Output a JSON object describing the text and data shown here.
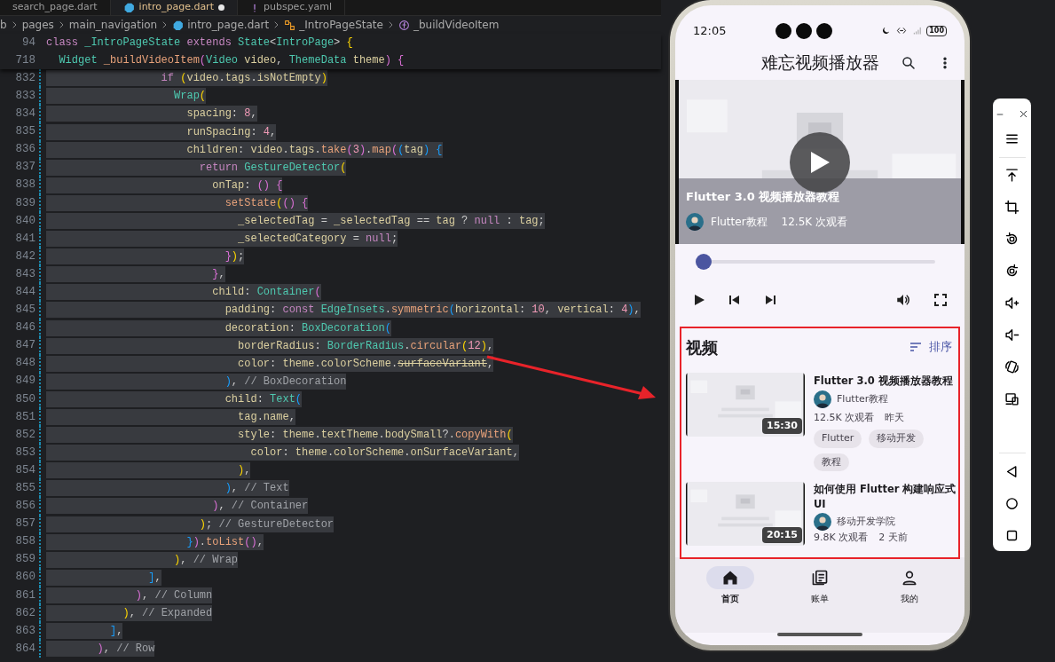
{
  "editor": {
    "tabs": [
      {
        "label": "search_page.dart",
        "kind": "plain",
        "selected": false,
        "modified": false
      },
      {
        "label": "intro_page.dart",
        "kind": "dart",
        "selected": true,
        "modified": true
      },
      {
        "label": "pubspec.yaml",
        "kind": "yaml",
        "selected": false,
        "modified": false
      }
    ],
    "breadcrumb": [
      {
        "label": "b",
        "kind": "folder"
      },
      {
        "label": "pages",
        "kind": "folder"
      },
      {
        "label": "main_navigation",
        "kind": "folder"
      },
      {
        "label": "intro_page.dart",
        "kind": "file"
      },
      {
        "label": "_IntroPageState",
        "kind": "class"
      },
      {
        "label": "_buildVideoItem",
        "kind": "method"
      }
    ],
    "sticky_lines": [
      {
        "number": "94",
        "tokens": [
          {
            "text": "class",
            "kind": "kw"
          },
          {
            "text": " _IntroPageState",
            "kind": "cls"
          },
          {
            "text": " extends",
            "kind": "kw"
          },
          {
            "text": " State",
            "kind": "cls"
          },
          {
            "text": "<",
            "kind": "p"
          },
          {
            "text": "IntroPage",
            "kind": "cls"
          },
          {
            "text": "> ",
            "kind": "p"
          },
          {
            "text": "{",
            "kind": "br1"
          }
        ]
      },
      {
        "number": "718",
        "tokens": [
          {
            "text": "  Widget",
            "kind": "cls"
          },
          {
            "text": " _buildVideoItem",
            "kind": "fn"
          },
          {
            "text": "(",
            "kind": "br2"
          },
          {
            "text": "Video",
            "kind": "cls"
          },
          {
            "text": " video",
            "kind": "id"
          },
          {
            "text": ", ",
            "kind": "p"
          },
          {
            "text": "ThemeData",
            "kind": "cls"
          },
          {
            "text": " theme",
            "kind": "id"
          },
          {
            "text": ")",
            "kind": "br2"
          },
          {
            "text": " {",
            "kind": "br2"
          }
        ]
      }
    ],
    "lines": [
      {
        "number": "832",
        "tokens": [
          {
            "text": "                  if",
            "kind": "kw"
          },
          {
            "text": " (",
            "kind": "br1"
          },
          {
            "text": "video",
            "kind": "id"
          },
          {
            "text": ".",
            "kind": "p"
          },
          {
            "text": "tags",
            "kind": "id"
          },
          {
            "text": ".",
            "kind": "p"
          },
          {
            "text": "isNotEmpty",
            "kind": "id"
          },
          {
            "text": ")",
            "kind": "br1"
          }
        ]
      },
      {
        "number": "833",
        "tokens": [
          {
            "text": "                    Wrap",
            "kind": "cls"
          },
          {
            "text": "(",
            "kind": "br1"
          }
        ]
      },
      {
        "number": "834",
        "tokens": [
          {
            "text": "                      spacing",
            "kind": "id"
          },
          {
            "text": ": ",
            "kind": "p"
          },
          {
            "text": "8",
            "kind": "num"
          },
          {
            "text": ",",
            "kind": "p"
          }
        ]
      },
      {
        "number": "835",
        "tokens": [
          {
            "text": "                      runSpacing",
            "kind": "id"
          },
          {
            "text": ": ",
            "kind": "p"
          },
          {
            "text": "4",
            "kind": "num"
          },
          {
            "text": ",",
            "kind": "p"
          }
        ]
      },
      {
        "number": "836",
        "tokens": [
          {
            "text": "                      children",
            "kind": "id"
          },
          {
            "text": ": ",
            "kind": "p"
          },
          {
            "text": "video",
            "kind": "id"
          },
          {
            "text": ".",
            "kind": "p"
          },
          {
            "text": "tags",
            "kind": "id"
          },
          {
            "text": ".",
            "kind": "p"
          },
          {
            "text": "take",
            "kind": "fn"
          },
          {
            "text": "(",
            "kind": "br2"
          },
          {
            "text": "3",
            "kind": "num"
          },
          {
            "text": ")",
            "kind": "br2"
          },
          {
            "text": ".",
            "kind": "p"
          },
          {
            "text": "map",
            "kind": "fn"
          },
          {
            "text": "(",
            "kind": "br2"
          },
          {
            "text": "(",
            "kind": "br3"
          },
          {
            "text": "tag",
            "kind": "id"
          },
          {
            "text": ")",
            "kind": "br3"
          },
          {
            "text": " {",
            "kind": "br3"
          }
        ]
      },
      {
        "number": "837",
        "tokens": [
          {
            "text": "                        return",
            "kind": "kw"
          },
          {
            "text": " GestureDetector",
            "kind": "cls"
          },
          {
            "text": "(",
            "kind": "br1"
          }
        ]
      },
      {
        "number": "838",
        "tokens": [
          {
            "text": "                          onTap",
            "kind": "id"
          },
          {
            "text": ": ",
            "kind": "p"
          },
          {
            "text": "()",
            "kind": "br2"
          },
          {
            "text": " {",
            "kind": "br2"
          }
        ]
      },
      {
        "number": "839",
        "tokens": [
          {
            "text": "                            setState",
            "kind": "fn"
          },
          {
            "text": "(",
            "kind": "br1"
          },
          {
            "text": "()",
            "kind": "br2"
          },
          {
            "text": " {",
            "kind": "br2"
          }
        ]
      },
      {
        "number": "840",
        "tokens": [
          {
            "text": "                              _selectedTag",
            "kind": "id"
          },
          {
            "text": " = ",
            "kind": "p"
          },
          {
            "text": "_selectedTag",
            "kind": "id"
          },
          {
            "text": " == ",
            "kind": "p"
          },
          {
            "text": "tag",
            "kind": "id"
          },
          {
            "text": " ? ",
            "kind": "p"
          },
          {
            "text": "null",
            "kind": "kw"
          },
          {
            "text": " : ",
            "kind": "p"
          },
          {
            "text": "tag",
            "kind": "id"
          },
          {
            "text": ";",
            "kind": "p"
          }
        ]
      },
      {
        "number": "841",
        "tokens": [
          {
            "text": "                              _selectedCategory",
            "kind": "id"
          },
          {
            "text": " = ",
            "kind": "p"
          },
          {
            "text": "null",
            "kind": "kw"
          },
          {
            "text": ";",
            "kind": "p"
          }
        ]
      },
      {
        "number": "842",
        "tokens": [
          {
            "text": "                            }",
            "kind": "br2"
          },
          {
            "text": ")",
            "kind": "br1"
          },
          {
            "text": ";",
            "kind": "p"
          }
        ]
      },
      {
        "number": "843",
        "tokens": [
          {
            "text": "                          }",
            "kind": "br2"
          },
          {
            "text": ",",
            "kind": "p"
          }
        ]
      },
      {
        "number": "844",
        "tokens": [
          {
            "text": "                          child",
            "kind": "id"
          },
          {
            "text": ": ",
            "kind": "p"
          },
          {
            "text": "Container",
            "kind": "cls"
          },
          {
            "text": "(",
            "kind": "br2"
          }
        ]
      },
      {
        "number": "845",
        "tokens": [
          {
            "text": "                            padding",
            "kind": "id"
          },
          {
            "text": ": ",
            "kind": "p"
          },
          {
            "text": "const",
            "kind": "kw"
          },
          {
            "text": " EdgeInsets",
            "kind": "cls"
          },
          {
            "text": ".",
            "kind": "p"
          },
          {
            "text": "symmetric",
            "kind": "fn"
          },
          {
            "text": "(",
            "kind": "br3"
          },
          {
            "text": "horizontal",
            "kind": "id"
          },
          {
            "text": ": ",
            "kind": "p"
          },
          {
            "text": "10",
            "kind": "num"
          },
          {
            "text": ", ",
            "kind": "p"
          },
          {
            "text": "vertical",
            "kind": "id"
          },
          {
            "text": ": ",
            "kind": "p"
          },
          {
            "text": "4",
            "kind": "num"
          },
          {
            "text": ")",
            "kind": "br3"
          },
          {
            "text": ",",
            "kind": "p"
          }
        ]
      },
      {
        "number": "846",
        "tokens": [
          {
            "text": "                            decoration",
            "kind": "id"
          },
          {
            "text": ": ",
            "kind": "p"
          },
          {
            "text": "BoxDecoration",
            "kind": "cls"
          },
          {
            "text": "(",
            "kind": "br3"
          }
        ]
      },
      {
        "number": "847",
        "tokens": [
          {
            "text": "                              borderRadius",
            "kind": "id"
          },
          {
            "text": ": ",
            "kind": "p"
          },
          {
            "text": "BorderRadius",
            "kind": "cls"
          },
          {
            "text": ".",
            "kind": "p"
          },
          {
            "text": "circular",
            "kind": "fn"
          },
          {
            "text": "(",
            "kind": "br1"
          },
          {
            "text": "12",
            "kind": "num"
          },
          {
            "text": ")",
            "kind": "br1"
          },
          {
            "text": ",",
            "kind": "p"
          }
        ]
      },
      {
        "number": "848",
        "tokens": [
          {
            "text": "                              color",
            "kind": "id"
          },
          {
            "text": ": ",
            "kind": "p"
          },
          {
            "text": "theme",
            "kind": "id"
          },
          {
            "text": ".",
            "kind": "p"
          },
          {
            "text": "colorScheme",
            "kind": "id"
          },
          {
            "text": ".",
            "kind": "p"
          },
          {
            "text": "surfaceVariant",
            "kind": "dep"
          },
          {
            "text": ",",
            "kind": "p"
          }
        ]
      },
      {
        "number": "849",
        "tokens": [
          {
            "text": "                            )",
            "kind": "br3"
          },
          {
            "text": ", ",
            "kind": "p"
          },
          {
            "text": "// BoxDecoration",
            "kind": "cm"
          }
        ]
      },
      {
        "number": "850",
        "tokens": [
          {
            "text": "                            child",
            "kind": "id"
          },
          {
            "text": ": ",
            "kind": "p"
          },
          {
            "text": "Text",
            "kind": "cls"
          },
          {
            "text": "(",
            "kind": "br3"
          }
        ]
      },
      {
        "number": "851",
        "tokens": [
          {
            "text": "                              tag",
            "kind": "id"
          },
          {
            "text": ".",
            "kind": "p"
          },
          {
            "text": "name",
            "kind": "id"
          },
          {
            "text": ",",
            "kind": "p"
          }
        ]
      },
      {
        "number": "852",
        "tokens": [
          {
            "text": "                              style",
            "kind": "id"
          },
          {
            "text": ": ",
            "kind": "p"
          },
          {
            "text": "theme",
            "kind": "id"
          },
          {
            "text": ".",
            "kind": "p"
          },
          {
            "text": "textTheme",
            "kind": "id"
          },
          {
            "text": ".",
            "kind": "p"
          },
          {
            "text": "bodySmall",
            "kind": "id"
          },
          {
            "text": "?.",
            "kind": "p"
          },
          {
            "text": "copyWith",
            "kind": "fn"
          },
          {
            "text": "(",
            "kind": "br1"
          }
        ]
      },
      {
        "number": "853",
        "tokens": [
          {
            "text": "                                color",
            "kind": "id"
          },
          {
            "text": ": ",
            "kind": "p"
          },
          {
            "text": "theme",
            "kind": "id"
          },
          {
            "text": ".",
            "kind": "p"
          },
          {
            "text": "colorScheme",
            "kind": "id"
          },
          {
            "text": ".",
            "kind": "p"
          },
          {
            "text": "onSurfaceVariant",
            "kind": "id"
          },
          {
            "text": ",",
            "kind": "p"
          }
        ]
      },
      {
        "number": "854",
        "tokens": [
          {
            "text": "                              )",
            "kind": "br1"
          },
          {
            "text": ",",
            "kind": "p"
          }
        ]
      },
      {
        "number": "855",
        "tokens": [
          {
            "text": "                            )",
            "kind": "br3"
          },
          {
            "text": ", ",
            "kind": "p"
          },
          {
            "text": "// Text",
            "kind": "cm"
          }
        ]
      },
      {
        "number": "856",
        "tokens": [
          {
            "text": "                          )",
            "kind": "br2"
          },
          {
            "text": ", ",
            "kind": "p"
          },
          {
            "text": "// Container",
            "kind": "cm"
          }
        ]
      },
      {
        "number": "857",
        "tokens": [
          {
            "text": "                        )",
            "kind": "br1"
          },
          {
            "text": "; ",
            "kind": "p"
          },
          {
            "text": "// GestureDetector",
            "kind": "cm"
          }
        ]
      },
      {
        "number": "858",
        "tokens": [
          {
            "text": "                      }",
            "kind": "br3"
          },
          {
            "text": ")",
            "kind": "br2"
          },
          {
            "text": ".",
            "kind": "p"
          },
          {
            "text": "toList",
            "kind": "fn"
          },
          {
            "text": "()",
            "kind": "br2"
          },
          {
            "text": ",",
            "kind": "p"
          }
        ]
      },
      {
        "number": "859",
        "tokens": [
          {
            "text": "                    )",
            "kind": "br1"
          },
          {
            "text": ", ",
            "kind": "p"
          },
          {
            "text": "// Wrap",
            "kind": "cm"
          }
        ]
      },
      {
        "number": "860",
        "tokens": [
          {
            "text": "                ]",
            "kind": "br3"
          },
          {
            "text": ",",
            "kind": "p"
          }
        ]
      },
      {
        "number": "861",
        "tokens": [
          {
            "text": "              )",
            "kind": "br2"
          },
          {
            "text": ", ",
            "kind": "p"
          },
          {
            "text": "// Column",
            "kind": "cm"
          }
        ]
      },
      {
        "number": "862",
        "tokens": [
          {
            "text": "            )",
            "kind": "br1"
          },
          {
            "text": ", ",
            "kind": "p"
          },
          {
            "text": "// Expanded",
            "kind": "cm"
          }
        ]
      },
      {
        "number": "863",
        "tokens": [
          {
            "text": "          ]",
            "kind": "br3"
          },
          {
            "text": ",",
            "kind": "p"
          }
        ]
      },
      {
        "number": "864",
        "tokens": [
          {
            "text": "        )",
            "kind": "br2"
          },
          {
            "text": ", ",
            "kind": "p"
          },
          {
            "text": "// Row",
            "kind": "cm"
          }
        ]
      }
    ]
  },
  "phone": {
    "status_bar": {
      "time": "12:05",
      "battery": "100"
    },
    "app_bar": {
      "title": "难忘视频播放器"
    },
    "player": {
      "title": "Flutter 3.0 视频播放器教程",
      "channel": "Flutter教程",
      "views": "12.5K 次观看",
      "progress": {
        "level": 0
      }
    },
    "section": {
      "title": "视频",
      "sort_label": "排序"
    },
    "videos": [
      {
        "title": "Flutter 3.0 视频播放器教程",
        "duration": "15:30",
        "channel": "Flutter教程",
        "views": "12.5K 次观看",
        "age": "昨天",
        "tags": [
          "Flutter",
          "移动开发",
          "教程"
        ]
      },
      {
        "title": "如何使用 Flutter 构建响应式 UI",
        "duration": "20:15",
        "channel": "移动开发学院",
        "views": "9.8K 次观看",
        "age": "2 天前"
      }
    ],
    "bottom_nav": [
      {
        "label": "首页",
        "kind": "home",
        "selected": true
      },
      {
        "label": "账单",
        "kind": "bill",
        "selected": false
      },
      {
        "label": "我的",
        "kind": "profile",
        "selected": false
      }
    ]
  }
}
